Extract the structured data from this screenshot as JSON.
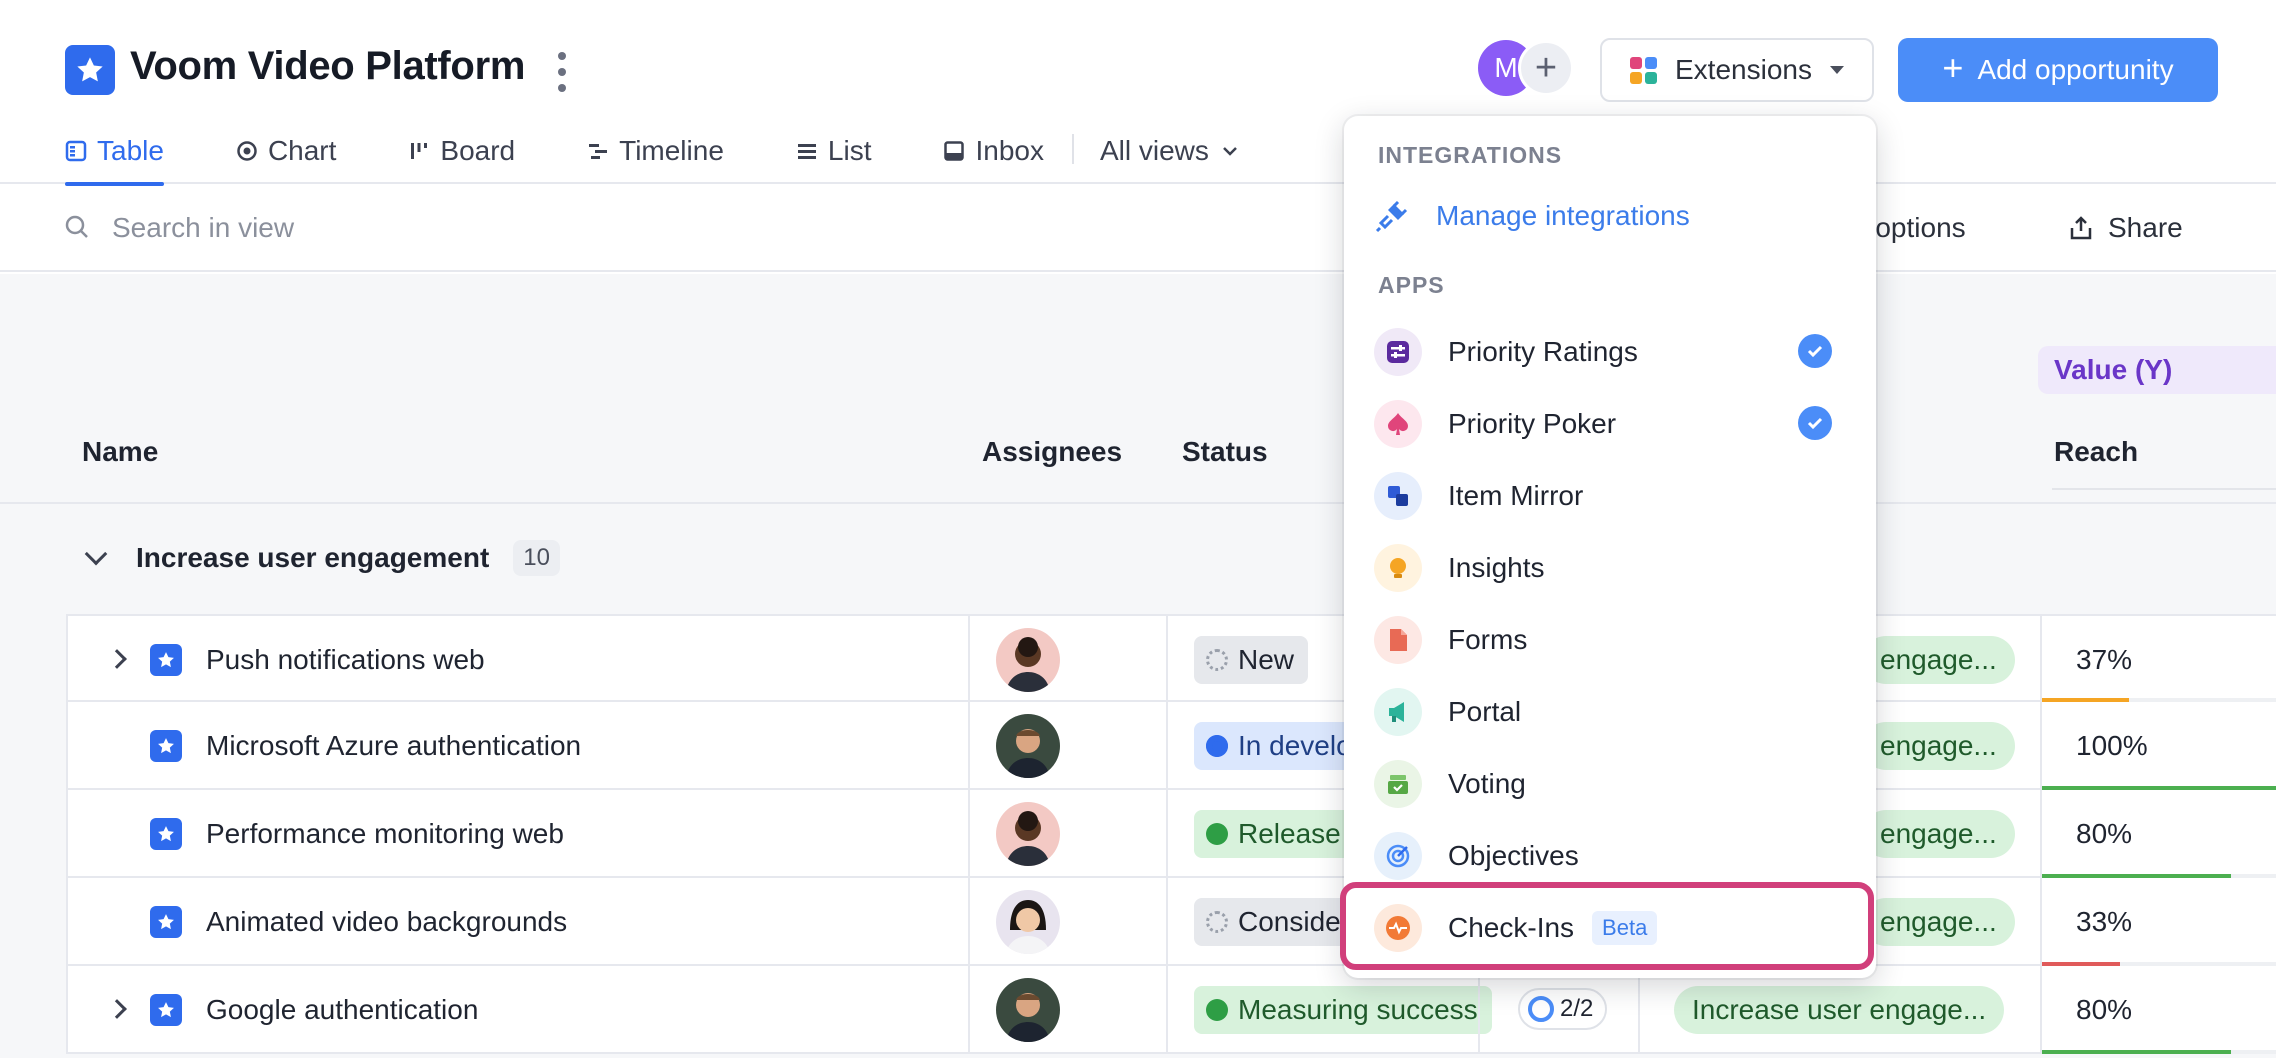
{
  "app": {
    "title": "Voom Video Platform"
  },
  "header": {
    "avatar_initial": "M",
    "extensions_label": "Extensions",
    "add_label": "Add opportunity"
  },
  "tabs": [
    {
      "label": "Table",
      "icon": "table-icon",
      "active": true
    },
    {
      "label": "Chart",
      "icon": "chart-icon"
    },
    {
      "label": "Board",
      "icon": "board-icon"
    },
    {
      "label": "Timeline",
      "icon": "timeline-icon"
    },
    {
      "label": "List",
      "icon": "list-icon"
    },
    {
      "label": "Inbox",
      "icon": "inbox-icon"
    },
    {
      "label": "All views",
      "icon": "chevron-down-icon"
    }
  ],
  "toolbar": {
    "search_placeholder": "Search in view",
    "display_options": "ay options",
    "share": "Share"
  },
  "table": {
    "columns": {
      "name": "Name",
      "assignees": "Assignees",
      "status": "Status",
      "reach": "Reach",
      "value_y": "Value (Y)"
    },
    "group": {
      "label": "Increase user engagement",
      "count": "10"
    },
    "rows": [
      {
        "name": "Push notifications web",
        "expandable": true,
        "status": "New",
        "objective": "engage...",
        "reach": "37%",
        "reach_fraction": 0.37,
        "reach_color": "#f5a524",
        "status_bg": "#e6e8ec",
        "status_dot": "#9aa0ab"
      },
      {
        "name": "Microsoft Azure authentication",
        "expandable": false,
        "status": "In develo",
        "objective": "engage...",
        "reach": "100%",
        "reach_fraction": 1.0,
        "reach_color": "#4caf50",
        "status_bg": "#dbe7fd",
        "status_dot": "#2f6bed"
      },
      {
        "name": "Performance monitoring web",
        "expandable": false,
        "status": "Release",
        "objective": "engage...",
        "reach": "80%",
        "reach_fraction": 0.8,
        "reach_color": "#4caf50",
        "status_bg": "#d8f2dc",
        "status_dot": "#2e9e45"
      },
      {
        "name": "Animated video backgrounds",
        "expandable": false,
        "status": "Conside",
        "objective": "engage...",
        "reach": "33%",
        "reach_fraction": 0.33,
        "reach_color": "#e05a5a",
        "status_bg": "#e6e8ec",
        "status_dot": "#9aa0ab"
      },
      {
        "name": "Google authentication",
        "expandable": true,
        "status": "Measuring success",
        "progress": "2/2",
        "objective": "Increase user engage...",
        "reach": "80%",
        "reach_fraction": 0.8,
        "reach_color": "#4caf50",
        "status_bg": "#d8f2dc",
        "status_dot": "#2e9e45"
      }
    ]
  },
  "dropdown": {
    "integrations_label": "INTEGRATIONS",
    "manage_label": "Manage integrations",
    "apps_label": "APPS",
    "apps": [
      {
        "label": "Priority Ratings",
        "checked": true,
        "icon": "sliders-icon",
        "bg": "#f0e9f7",
        "fg": "#5b2a9e"
      },
      {
        "label": "Priority Poker",
        "checked": true,
        "icon": "spade-icon",
        "bg": "#fde7ee",
        "fg": "#e0457b"
      },
      {
        "label": "Item Mirror",
        "checked": false,
        "icon": "mirror-icon",
        "bg": "#e6eefc",
        "fg": "#2f5bd6"
      },
      {
        "label": "Insights",
        "checked": false,
        "icon": "lightbulb-icon",
        "bg": "#fff3df",
        "fg": "#f5a524"
      },
      {
        "label": "Forms",
        "checked": false,
        "icon": "document-icon",
        "bg": "#fde8e4",
        "fg": "#e86a55"
      },
      {
        "label": "Portal",
        "checked": false,
        "icon": "megaphone-icon",
        "bg": "#e2f6f1",
        "fg": "#2bb39a"
      },
      {
        "label": "Voting",
        "checked": false,
        "icon": "ballot-box-icon",
        "bg": "#eaf5e6",
        "fg": "#56a845"
      },
      {
        "label": "Objectives",
        "checked": false,
        "icon": "target-icon",
        "bg": "#e6f0fb",
        "fg": "#4b8df8"
      },
      {
        "label": "Check-Ins",
        "checked": false,
        "beta": "Beta",
        "icon": "pulse-icon",
        "bg": "#fde9dc",
        "fg": "#f27a36"
      }
    ]
  },
  "colors": {
    "accent": "#2f6bed",
    "primary_button": "#4b8df8",
    "highlight": "#d13f7b"
  }
}
